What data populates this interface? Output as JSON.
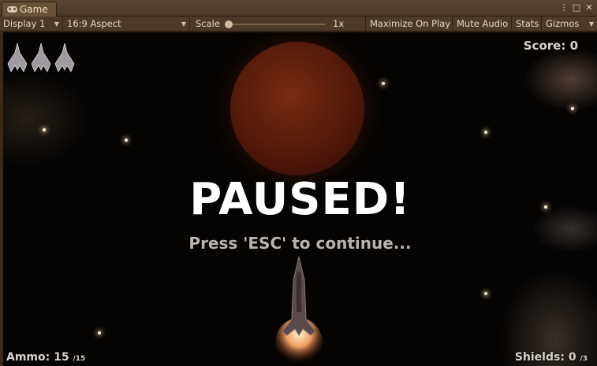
{
  "window": {
    "tab_label": "Game",
    "menu_glyph": "⋮",
    "maximize_glyph": "□",
    "close_glyph": "✕"
  },
  "toolbar": {
    "display": "Display 1",
    "aspect": "16:9 Aspect",
    "scale_label": "Scale",
    "scale_value": "1x",
    "maximize_on_play": "Maximize On Play",
    "mute_audio": "Mute Audio",
    "stats": "Stats",
    "gizmos": "Gizmos"
  },
  "hud": {
    "score_label": "Score:",
    "score_value": "0",
    "ammo_label": "Ammo:",
    "ammo_value": "15",
    "ammo_max": "/15",
    "shields_label": "Shields:",
    "shields_value": "0",
    "shields_max": "/3",
    "lives_count": 3
  },
  "overlay": {
    "title": "PAUSED!",
    "subtitle": "Press 'ESC' to continue..."
  },
  "colors": {
    "editor_bg": "#4b3a27",
    "hud_text": "#d8d3cc",
    "paused_text": "#ffffff",
    "planet": "#7a2a12"
  }
}
